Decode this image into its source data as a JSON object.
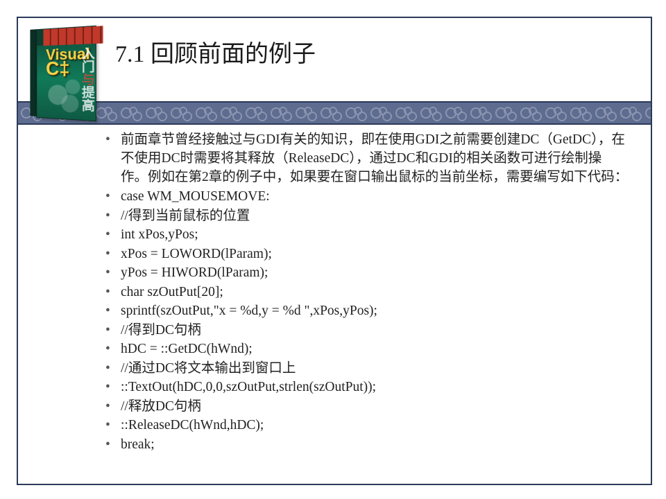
{
  "book": {
    "big_title_line1": "Visual",
    "big_title_line2": "C‡",
    "vert1": "入门",
    "vert_red": "与",
    "vert2": "提高"
  },
  "title": "7.1  回顾前面的例子",
  "bullets": [
    "前面章节曾经接触过与GDI有关的知识，即在使用GDI之前需要创建DC（GetDC），在不使用DC时需要将其释放（ReleaseDC），通过DC和GDI的相关函数可进行绘制操作。例如在第2章的例子中，如果要在窗口输出鼠标的当前坐标，需要编写如下代码：",
    "case WM_MOUSEMOVE:",
    "//得到当前鼠标的位置",
    "int xPos,yPos;",
    "xPos = LOWORD(lParam);",
    "yPos = HIWORD(lParam);",
    "char szOutPut[20];",
    "sprintf(szOutPut,\"x = %d,y = %d     \",xPos,yPos);",
    "//得到DC句柄",
    "hDC = ::GetDC(hWnd);",
    "//通过DC将文本输出到窗口上",
    "::TextOut(hDC,0,0,szOutPut,strlen(szOutPut));",
    "//释放DC句柄",
    "::ReleaseDC(hWnd,hDC);",
    "break;"
  ]
}
